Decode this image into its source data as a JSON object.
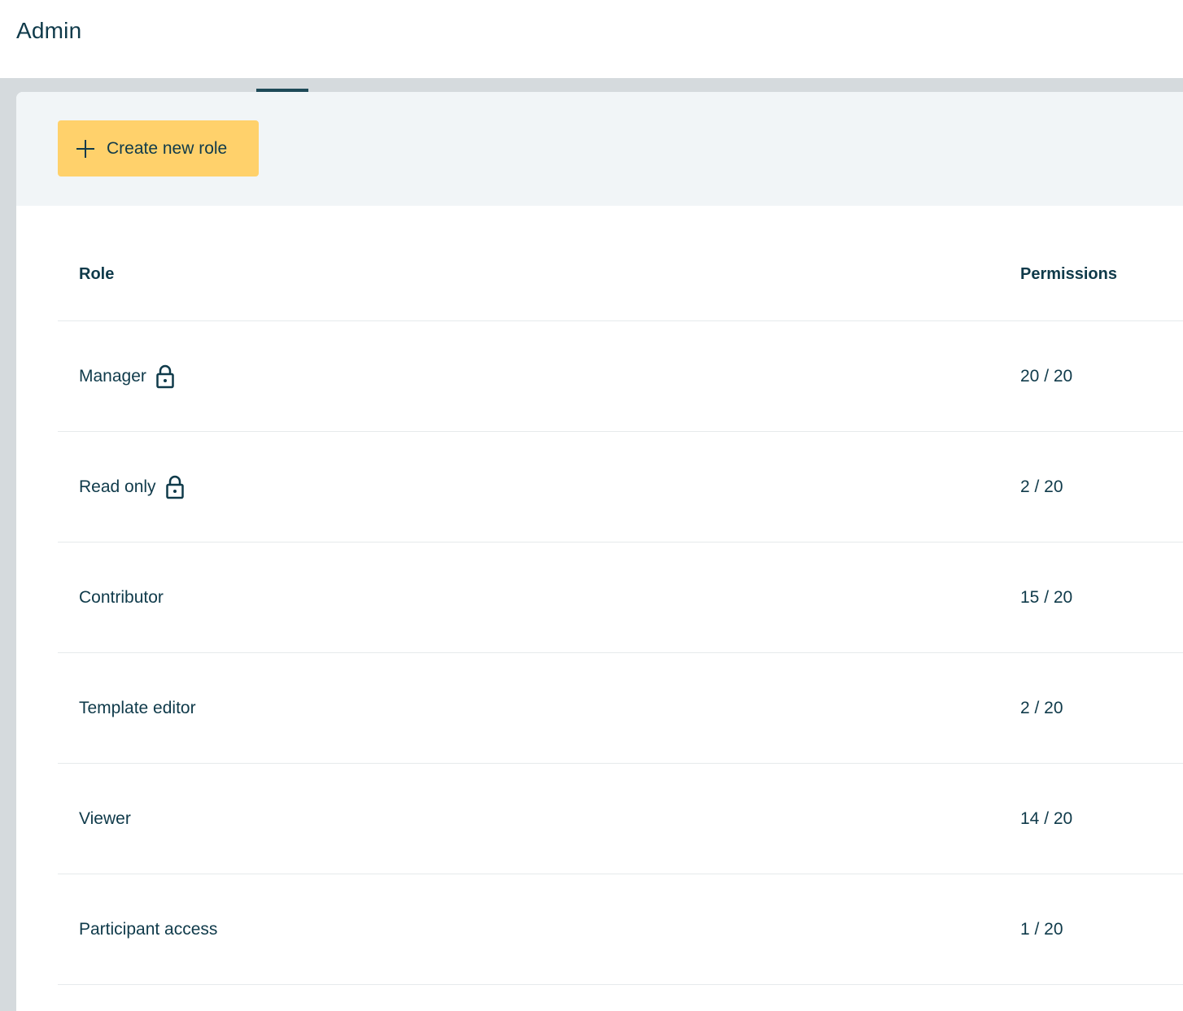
{
  "header": {
    "title": "Admin"
  },
  "toolbar": {
    "create_label": "Create new role",
    "create_icon": "plus-icon",
    "button_color": "#ffd16b"
  },
  "table": {
    "columns": {
      "role": "Role",
      "permissions": "Permissions"
    },
    "rows": [
      {
        "role": "Manager",
        "locked": true,
        "permissions": "20 / 20"
      },
      {
        "role": "Read only",
        "locked": true,
        "permissions": "2 / 20"
      },
      {
        "role": "Contributor",
        "locked": false,
        "permissions": "15 / 20"
      },
      {
        "role": "Template editor",
        "locked": false,
        "permissions": "2 / 20"
      },
      {
        "role": "Viewer",
        "locked": false,
        "permissions": "14 / 20"
      },
      {
        "role": "Participant access",
        "locked": false,
        "permissions": "1 / 20"
      }
    ]
  },
  "colors": {
    "text": "#0f3a4a",
    "accent": "#ffd16b",
    "toolbar_bg": "#f1f5f7"
  }
}
